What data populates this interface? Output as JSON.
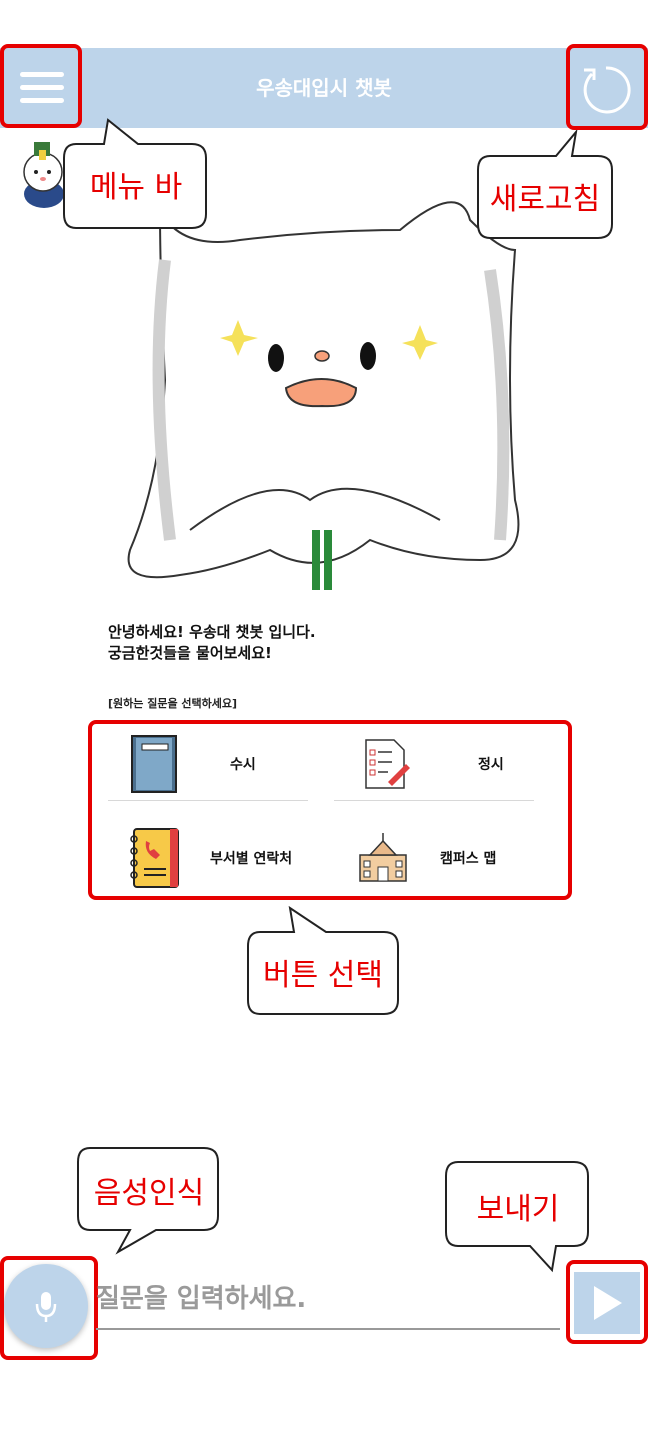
{
  "header": {
    "title": "우송대입시 챗봇",
    "menu_icon": "hamburger-icon",
    "refresh_icon": "refresh-icon"
  },
  "callouts": {
    "menu": "메뉴 바",
    "refresh": "새로고침",
    "buttons": "버튼 선택",
    "voice": "음성인식",
    "send": "보내기"
  },
  "chat": {
    "greeting_line1": "안녕하세요! 우송대 챗봇 입니다.",
    "greeting_line2": "궁금한것들을 물어보세요!",
    "hint": "[원하는 질문을 선택하세요]"
  },
  "menu_buttons": [
    {
      "label": "수시",
      "icon": "notebook-icon"
    },
    {
      "label": "정시",
      "icon": "checklist-icon"
    },
    {
      "label": "부서별 연락처",
      "icon": "phonebook-icon"
    },
    {
      "label": "캠퍼스 맵",
      "icon": "school-building-icon"
    }
  ],
  "input": {
    "placeholder": "질문을 입력하세요.",
    "mic_icon": "microphone-icon",
    "send_icon": "send-triangle-icon"
  },
  "colors": {
    "header": "#bdd4ea",
    "accent_red": "#e60000"
  }
}
